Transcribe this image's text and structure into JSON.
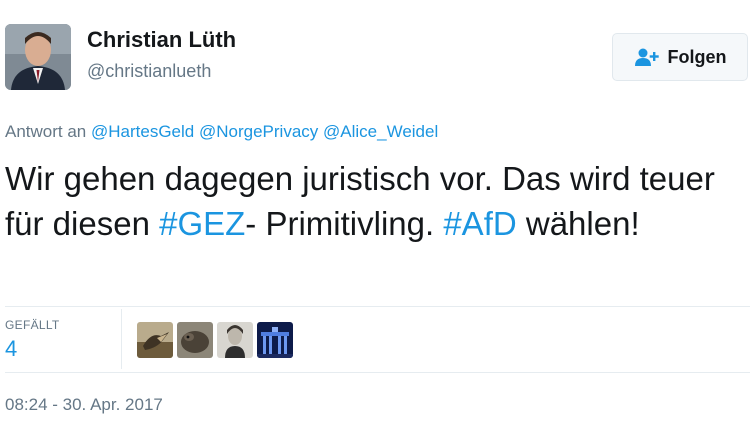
{
  "author": {
    "name": "Christian Lüth",
    "handle": "@christianlueth"
  },
  "follow_button": {
    "label": "Folgen",
    "icon": "add-user-icon"
  },
  "reply": {
    "prefix": "Antwort an",
    "mentions": [
      "@HartesGeld",
      "@NorgePrivacy",
      "@Alice_Weidel"
    ]
  },
  "tweet": {
    "text_part1": "Wir gehen dagegen juristisch vor. Das wird teuer für diesen ",
    "hashtag1": "#GEZ",
    "text_part2": "- Primitivling. ",
    "hashtag2": "#AfD",
    "text_part3": " wählen!"
  },
  "stats": {
    "likes_label": "GEFÄLLT",
    "likes_count": "4",
    "likers": [
      "bird-photo-avatar",
      "animal-photo-avatar",
      "portrait-photo-avatar",
      "brandenburg-gate-avatar"
    ]
  },
  "timestamp": "08:24 - 30. Apr. 2017",
  "colors": {
    "link": "#1b95e0",
    "secondary_text": "#657786",
    "primary_text": "#14171a",
    "divider": "#e6ecf0"
  }
}
